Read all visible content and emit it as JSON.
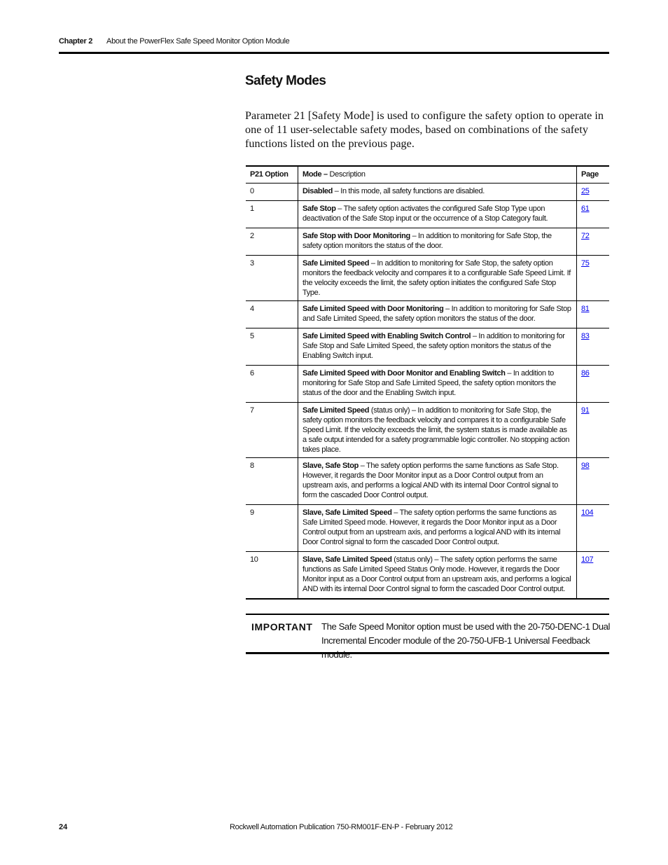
{
  "header": {
    "chapter": "Chapter 2",
    "title": "About the PowerFlex Safe Speed Monitor Option Module"
  },
  "section_title": "Safety Modes",
  "intro": "Parameter 21 [Safety Mode] is used to configure the safety option to operate in one of 11 user-selectable safety modes, based on combinations of the safety functions listed on the previous page.",
  "table": {
    "headers": {
      "option": "P21 Option",
      "mode_bold": "Mode –",
      "mode_rest": " Description",
      "page": "Page"
    },
    "rows": [
      {
        "option": "0",
        "mode": "Disabled",
        "rest": " – In this mode, all safety functions are disabled.",
        "page": "25"
      },
      {
        "option": "1",
        "mode": "Safe Stop",
        "rest": " – The safety option activates the configured Safe Stop Type upon deactivation of the Safe Stop input or the occurrence of a Stop Category fault.",
        "page": "61"
      },
      {
        "option": "2",
        "mode": "Safe Stop with Door Monitoring",
        "rest": " – In addition to monitoring for Safe Stop, the safety option monitors the status of the door.",
        "page": "72"
      },
      {
        "option": "3",
        "mode": "Safe Limited Speed",
        "rest": " – In addition to monitoring for Safe Stop, the safety option monitors the feedback velocity and compares it to a configurable Safe Speed Limit. If the velocity exceeds the limit, the safety option initiates the configured Safe Stop Type.",
        "page": "75"
      },
      {
        "option": "4",
        "mode": "Safe Limited Speed with Door Monitoring",
        "rest": " – In addition to monitoring for Safe Stop and Safe Limited Speed, the safety option monitors the status of the door.",
        "page": "81"
      },
      {
        "option": "5",
        "mode": "Safe Limited Speed with Enabling Switch Control",
        "rest": " – In addition to monitoring for Safe Stop and Safe Limited Speed, the safety option monitors the status of the Enabling Switch input.",
        "page": "83"
      },
      {
        "option": "6",
        "mode": "Safe Limited Speed with Door Monitor and Enabling Switch",
        "rest": " – In addition to monitoring for Safe Stop and Safe Limited Speed, the safety option monitors the status of the door and the Enabling Switch input.",
        "page": "86"
      },
      {
        "option": "7",
        "mode": "Safe Limited Speed",
        "rest": " (status only) – In addition to monitoring for Safe Stop, the safety option monitors the feedback velocity and compares it to a configurable Safe Speed Limit. If the velocity exceeds the limit, the system status is made available as a safe output intended for a safety programmable logic controller. No stopping action takes place.",
        "page": "91"
      },
      {
        "option": "8",
        "mode": "Slave, Safe Stop",
        "rest": " – The safety option performs the same functions as Safe Stop. However, it regards the Door Monitor input as a Door Control output from an upstream axis, and performs a logical AND with its internal Door Control signal to form the cascaded Door Control output.",
        "page": "98"
      },
      {
        "option": "9",
        "mode": "Slave, Safe Limited Speed",
        "rest": " – The safety option performs the same functions as Safe Limited Speed mode. However, it regards the Door Monitor input as a Door Control output from an upstream axis, and performs a logical AND with its internal Door Control signal to form the cascaded Door Control output.",
        "page": "104"
      },
      {
        "option": "10",
        "mode": "Slave, Safe Limited Speed",
        "rest": " (status only) – The safety option performs the same functions as Safe Limited Speed Status Only mode. However, it regards the Door Monitor input as a Door Control output from an upstream axis, and performs a logical AND with its internal Door Control signal to form the cascaded Door Control output.",
        "page": "107"
      }
    ]
  },
  "important": {
    "label": "IMPORTANT",
    "text": "The Safe Speed Monitor option must be used with the 20-750-DENC-1 Dual Incremental Encoder module of the 20-750-UFB-1 Universal Feedback module."
  },
  "footer": {
    "page_number": "24",
    "publication": "Rockwell Automation Publication 750-RM001F-EN-P - February 2012"
  }
}
